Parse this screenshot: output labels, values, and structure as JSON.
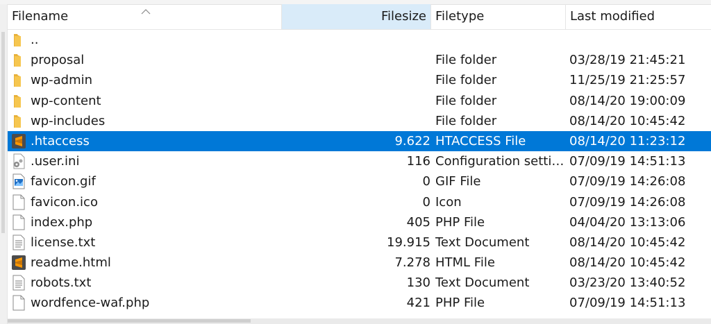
{
  "columns": {
    "filename": "Filename",
    "filesize": "Filesize",
    "filetype": "Filetype",
    "last_modified": "Last modified"
  },
  "sort": {
    "column": "filename",
    "direction": "ascending"
  },
  "colors": {
    "selection": "#0078d7",
    "sorted_column_header": "#d9ebf9",
    "folder": "#f6c64f"
  },
  "rows": [
    {
      "name": "..",
      "size": "",
      "type": "",
      "modified": "",
      "icon": "folder-icon"
    },
    {
      "name": "proposal",
      "size": "",
      "type": "File folder",
      "modified": "03/28/19 21:45:21",
      "icon": "folder-icon"
    },
    {
      "name": "wp-admin",
      "size": "",
      "type": "File folder",
      "modified": "11/25/19 21:25:57",
      "icon": "folder-icon"
    },
    {
      "name": "wp-content",
      "size": "",
      "type": "File folder",
      "modified": "08/14/20 19:00:09",
      "icon": "folder-icon"
    },
    {
      "name": "wp-includes",
      "size": "",
      "type": "File folder",
      "modified": "08/14/20 10:45:42",
      "icon": "folder-icon"
    },
    {
      "name": ".htaccess",
      "size": "9.622",
      "type": "HTACCESS File",
      "modified": "08/14/20 11:23:12",
      "icon": "sublime-file-icon",
      "selected": true
    },
    {
      "name": ".user.ini",
      "size": "116",
      "type": "Configuration settin...",
      "modified": "07/09/19 14:51:13",
      "icon": "settings-file-icon"
    },
    {
      "name": "favicon.gif",
      "size": "0",
      "type": "GIF File",
      "modified": "07/09/19 14:26:08",
      "icon": "image-file-icon"
    },
    {
      "name": "favicon.ico",
      "size": "0",
      "type": "Icon",
      "modified": "07/09/19 14:26:08",
      "icon": "blank-file-icon"
    },
    {
      "name": "index.php",
      "size": "405",
      "type": "PHP File",
      "modified": "04/04/20 13:13:06",
      "icon": "blank-file-icon"
    },
    {
      "name": "license.txt",
      "size": "19.915",
      "type": "Text Document",
      "modified": "08/14/20 10:45:42",
      "icon": "text-file-icon"
    },
    {
      "name": "readme.html",
      "size": "7.278",
      "type": "HTML File",
      "modified": "08/14/20 10:45:42",
      "icon": "sublime-file-icon"
    },
    {
      "name": "robots.txt",
      "size": "130",
      "type": "Text Document",
      "modified": "03/23/20 13:40:52",
      "icon": "text-file-icon"
    },
    {
      "name": "wordfence-waf.php",
      "size": "421",
      "type": "PHP File",
      "modified": "07/09/19 14:51:13",
      "icon": "blank-file-icon"
    }
  ]
}
